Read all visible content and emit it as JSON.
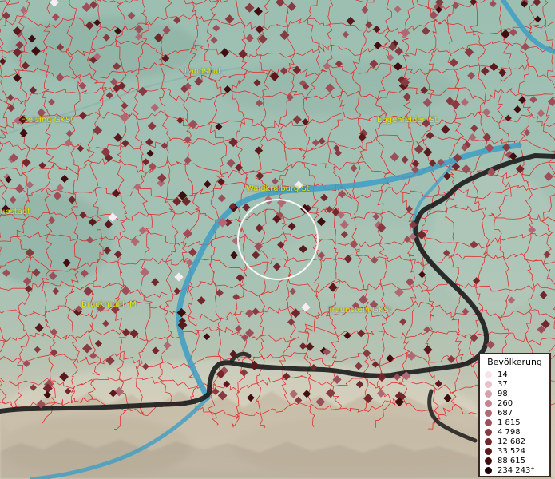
{
  "map": {
    "place_labels": [
      {
        "id": "landshut",
        "text": "Landshut"
      },
      {
        "id": "freising",
        "text": "Freising GKSt"
      },
      {
        "id": "eggenfelden",
        "text": "Eggenfelden St"
      },
      {
        "id": "waldkraiburg",
        "text": "Waldkraiburg St"
      },
      {
        "id": "hauptstadt",
        "text": "upstadt"
      },
      {
        "id": "bruckmuehl",
        "text": "Bruckmühl, M"
      },
      {
        "id": "traunstein",
        "text": "Traunstein GKSt"
      }
    ],
    "colors": {
      "boundary": "#e52222",
      "river": "#3d9ec4",
      "country_border": "#1b1b1b",
      "label": "#e8e600",
      "selection_circle": "#ffffff"
    }
  },
  "legend": {
    "title": "Bevölkerung",
    "entries": [
      {
        "label": "14",
        "color": "#f7e3ea"
      },
      {
        "label": "37",
        "color": "#e8c0cc"
      },
      {
        "label": "98",
        "color": "#d8a0ad"
      },
      {
        "label": "260",
        "color": "#c58390"
      },
      {
        "label": "687",
        "color": "#b06873"
      },
      {
        "label": "1 815",
        "color": "#9c4f58"
      },
      {
        "label": "4 798",
        "color": "#883a41"
      },
      {
        "label": "12 682",
        "color": "#72272c"
      },
      {
        "label": "33 524",
        "color": "#5a191c"
      },
      {
        "label": "88 615",
        "color": "#3e0e10"
      },
      {
        "label": "234 243⁺",
        "color": "#1e0507"
      }
    ]
  }
}
